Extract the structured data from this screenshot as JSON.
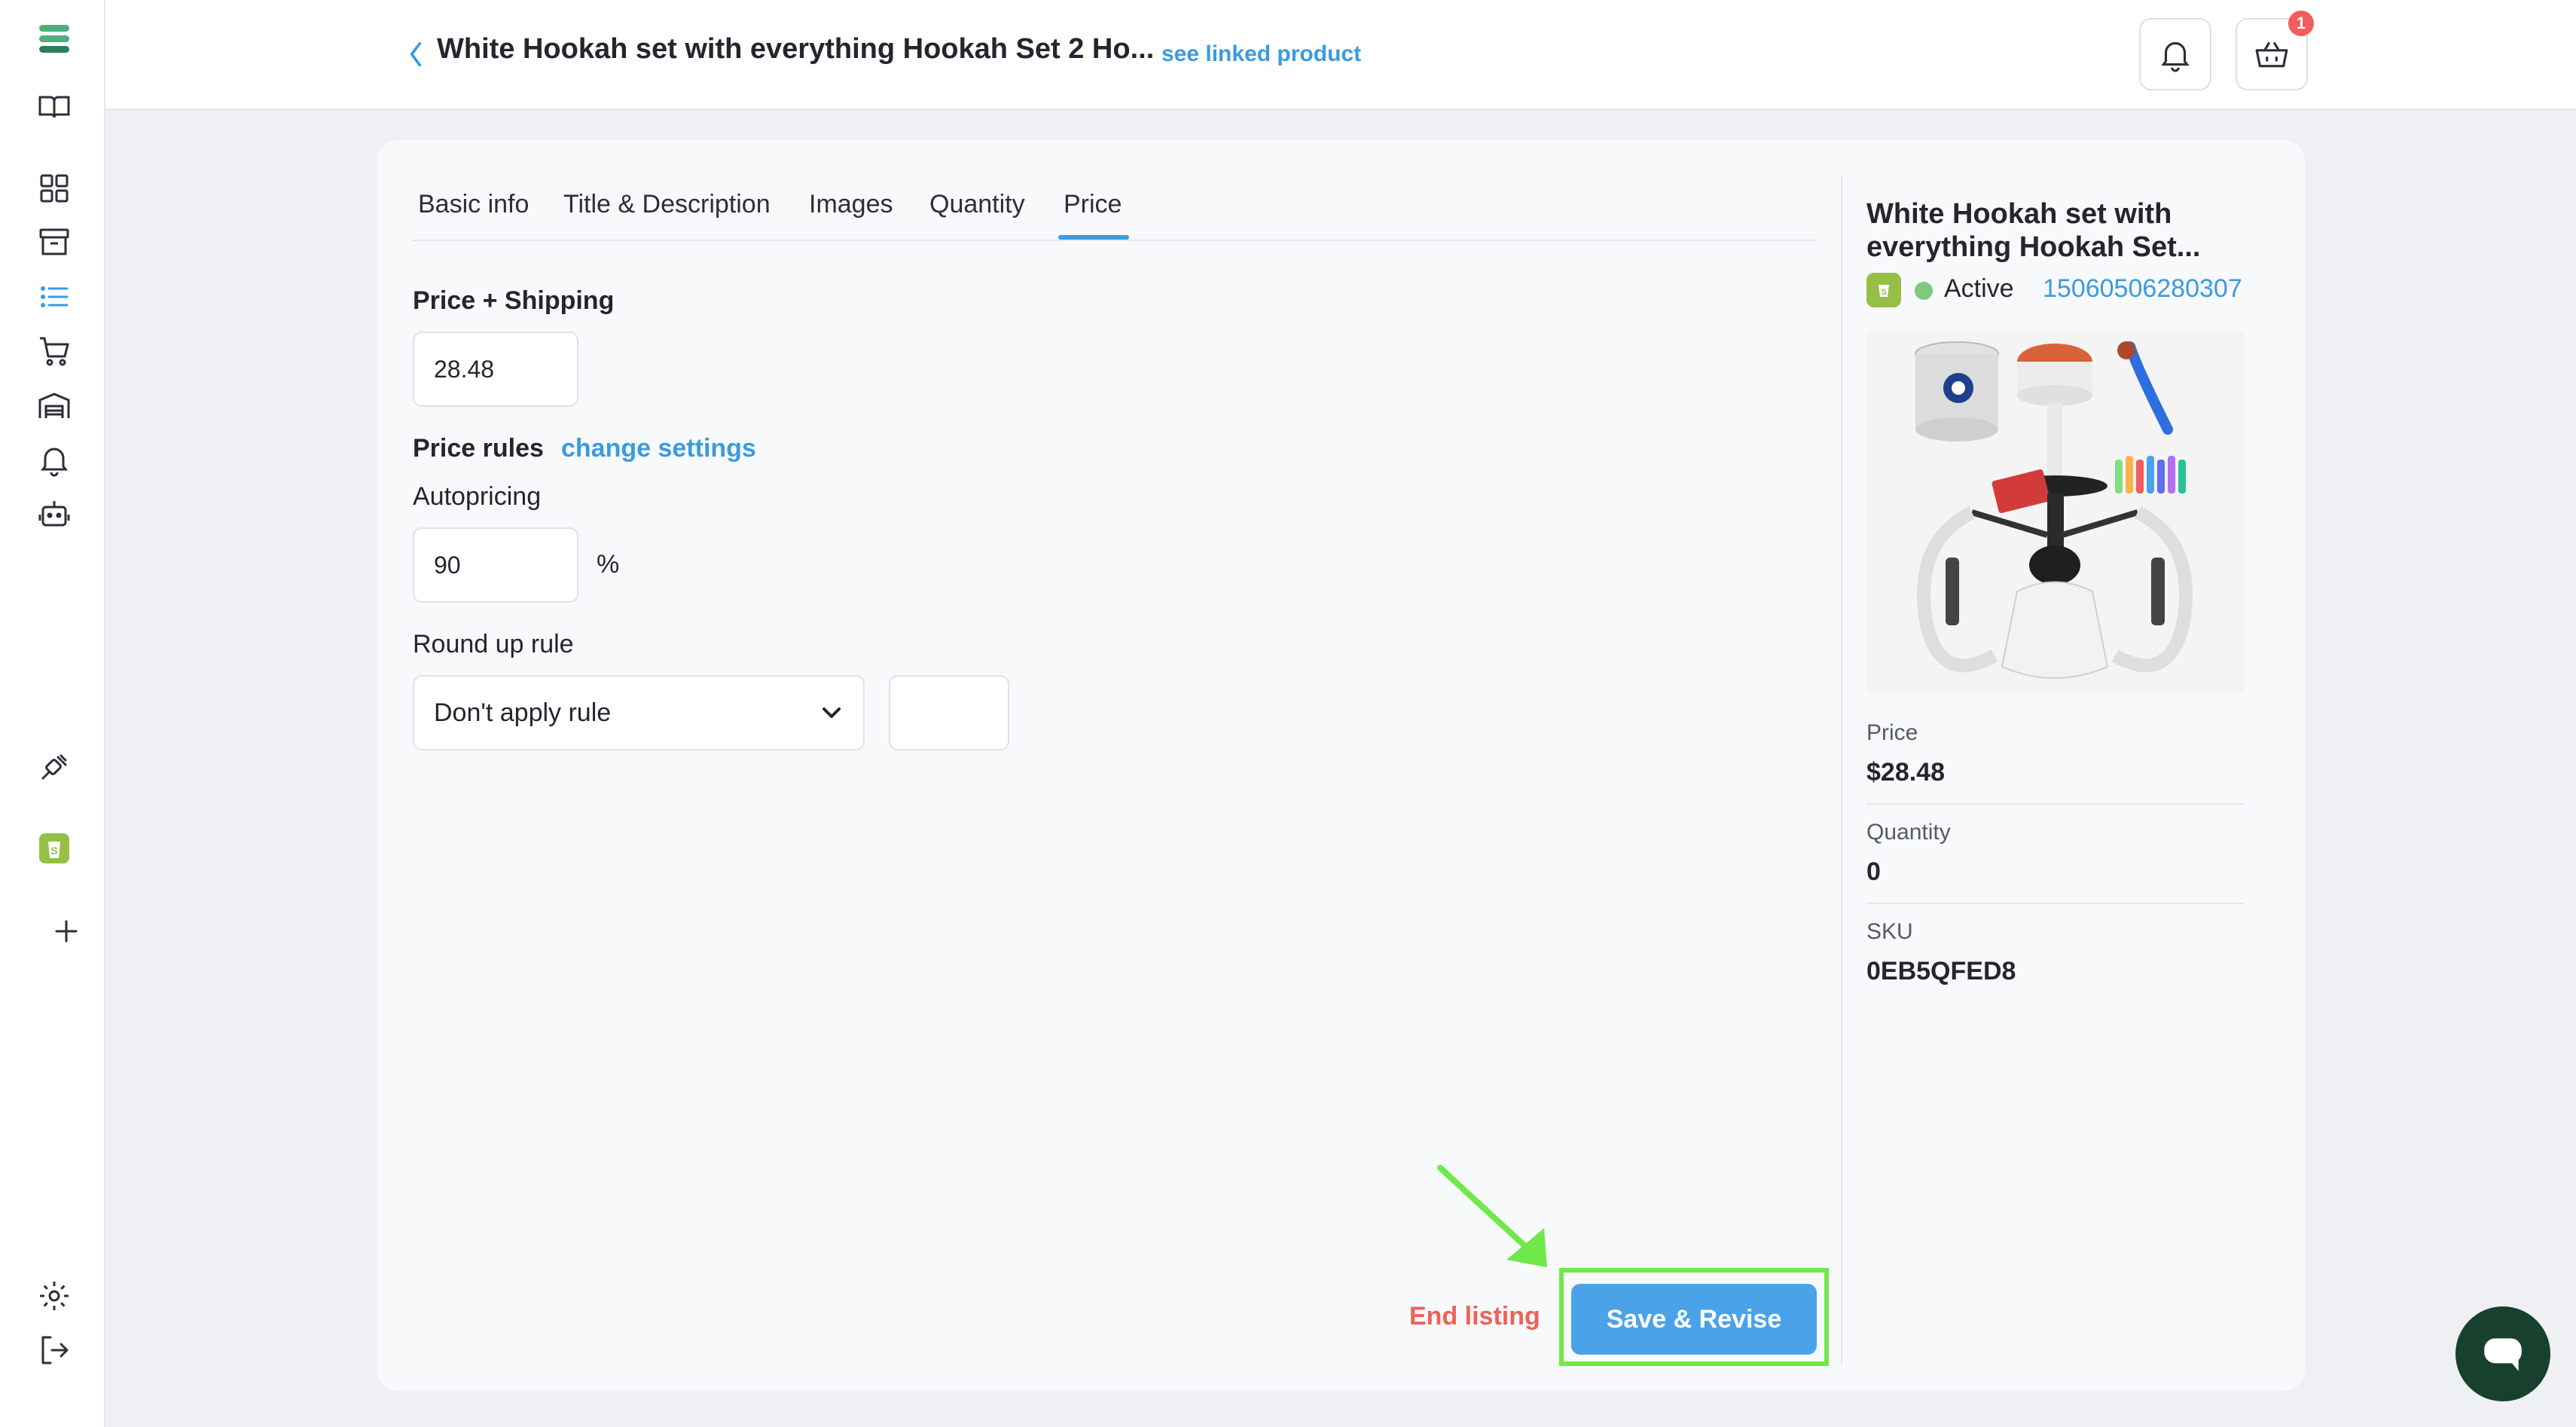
{
  "header": {
    "title": "White Hookah set with everything Hookah Set 2 Ho...",
    "linked_link": "see linked product",
    "cart_badge": "1"
  },
  "tabs": [
    {
      "label": "Basic info"
    },
    {
      "label": "Title & Description"
    },
    {
      "label": "Images"
    },
    {
      "label": "Quantity"
    },
    {
      "label": "Price",
      "active": true
    }
  ],
  "price_form": {
    "price_shipping_label": "Price + Shipping",
    "price_shipping_value": "28.48",
    "price_rules_label": "Price rules",
    "change_settings_link": "change settings",
    "autopricing_label": "Autopricing",
    "autopricing_value": "90",
    "percent_symbol": "%",
    "round_up_label": "Round up rule",
    "round_up_selected": "Don't apply rule",
    "round_up_value": ""
  },
  "product_panel": {
    "title": "White Hookah set with everything Hookah Set...",
    "status": "Active",
    "status_color": "#7ec97e",
    "product_id": "15060506280307",
    "price_label": "Price",
    "price_value": "$28.48",
    "quantity_label": "Quantity",
    "quantity_value": "0",
    "sku_label": "SKU",
    "sku_value": "0EB5QFED8"
  },
  "actions": {
    "end_listing": "End listing",
    "save_revise": "Save & Revise"
  },
  "colors": {
    "accent": "#3a9be0",
    "danger": "#f06158",
    "highlight": "#6fe94a",
    "shopify": "#95bf47"
  }
}
